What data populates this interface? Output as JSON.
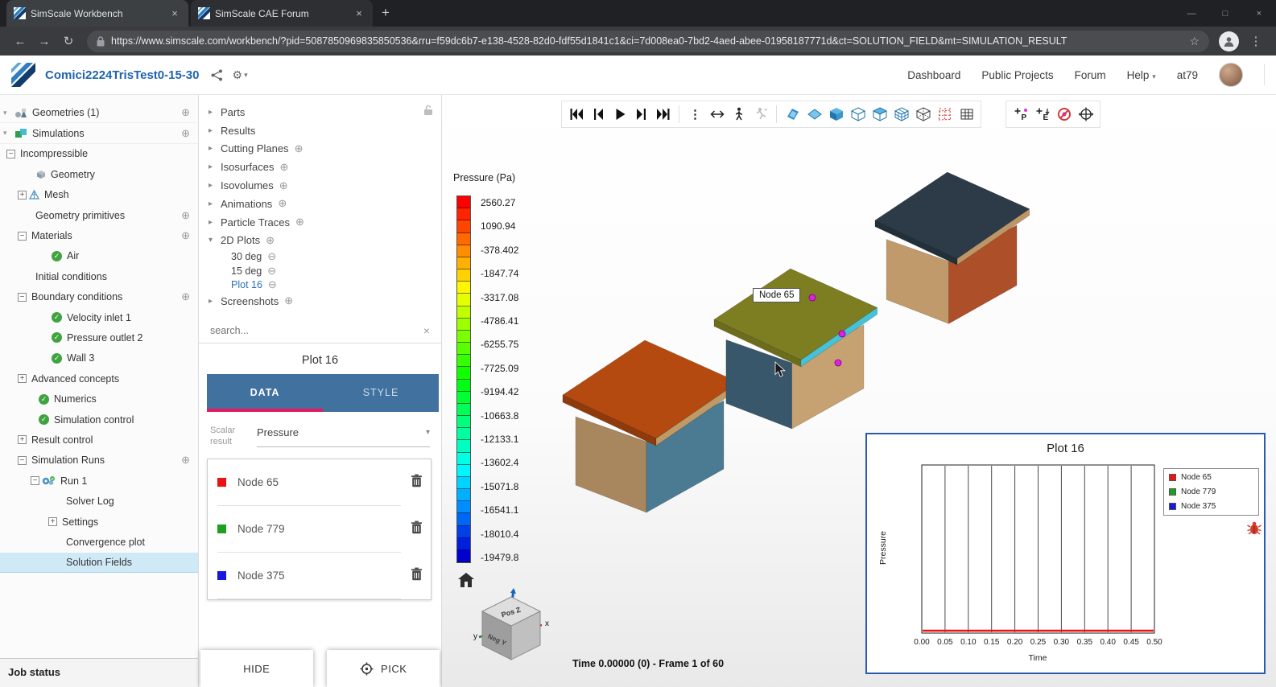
{
  "colors": {
    "brand_blue": "#1f64ad",
    "panel_tab_bg": "#40719f",
    "tab_active_underline": "#e5195f",
    "selected_row_bg": "#cfe9f7",
    "selected_tree_text": "#2a72b8",
    "check_green": "#3fa33f",
    "node_magenta": "#e020e0",
    "plot_border_blue": "#2a5caa"
  },
  "icons": {
    "back": "←",
    "forward": "→",
    "reload": "↻",
    "star": "☆",
    "kebab": "⋮",
    "minimize": "—",
    "maximize": "□",
    "close": "×",
    "new_tab": "+",
    "tab_close": "×",
    "plus_circle": "⊕",
    "minus_circle": "⊖",
    "box_plus": "+",
    "box_minus": "−",
    "chevron_right": "▸",
    "chevron_down": "▾",
    "caret_down": "▾",
    "check": "✓",
    "clear": "×",
    "gear": "⚙"
  },
  "browser": {
    "tabs": [
      {
        "title": "SimScale Workbench"
      },
      {
        "title": "SimScale CAE Forum"
      }
    ],
    "url": "https://www.simscale.com/workbench/?pid=5087850969835850536&rru=f59dc6b7-e138-4528-82d0-fdf55d1841c1&ci=7d008ea0-7bd2-4aed-abee-01958187771d&ct=SOLUTION_FIELD&mt=SIMULATION_RESULT"
  },
  "header": {
    "project_title": "Comici2224TrisTest0-15-30",
    "nav_dashboard": "Dashboard",
    "nav_public_projects": "Public Projects",
    "nav_forum": "Forum",
    "nav_help": "Help",
    "username": "at79"
  },
  "sim_tree": {
    "items": [
      {
        "label": "Geometries (1)"
      },
      {
        "label": "Simulations"
      },
      {
        "label": "Incompressible"
      },
      {
        "label": "Geometry"
      },
      {
        "label": "Mesh"
      },
      {
        "label": "Geometry primitives"
      },
      {
        "label": "Materials"
      },
      {
        "label": "Air"
      },
      {
        "label": "Initial conditions"
      },
      {
        "label": "Boundary conditions"
      },
      {
        "label": "Velocity inlet 1"
      },
      {
        "label": "Pressure outlet 2"
      },
      {
        "label": "Wall 3"
      },
      {
        "label": "Advanced concepts"
      },
      {
        "label": "Numerics"
      },
      {
        "label": "Simulation control"
      },
      {
        "label": "Result control"
      },
      {
        "label": "Simulation Runs"
      },
      {
        "label": "Run 1"
      },
      {
        "label": "Solver Log"
      },
      {
        "label": "Settings"
      },
      {
        "label": "Convergence plot"
      },
      {
        "label": "Solution Fields"
      }
    ],
    "job_status": "Job status"
  },
  "post_tree": {
    "items": [
      {
        "label": "Parts"
      },
      {
        "label": "Results"
      },
      {
        "label": "Cutting Planes"
      },
      {
        "label": "Isosurfaces"
      },
      {
        "label": "Isovolumes"
      },
      {
        "label": "Animations"
      },
      {
        "label": "Particle Traces"
      },
      {
        "label": "2D Plots"
      },
      {
        "label": "30 deg"
      },
      {
        "label": "15 deg"
      },
      {
        "label": "Plot 16"
      },
      {
        "label": "Screenshots"
      }
    ],
    "search_placeholder": "search..."
  },
  "plot_panel": {
    "title": "Plot 16",
    "tab_data": "DATA",
    "tab_style": "STYLE",
    "scalar_label": "Scalar result",
    "scalar_value": "Pressure",
    "hide_button": "HIDE",
    "pick_button": "PICK"
  },
  "legend": {
    "title": "Pressure (Pa)",
    "values": [
      "2560.27",
      "1090.94",
      "-378.402",
      "-1847.74",
      "-3317.08",
      "-4786.41",
      "-6255.75",
      "-7725.09",
      "-9194.42",
      "-10663.8",
      "-12133.1",
      "-13602.4",
      "-15071.8",
      "-16541.1",
      "-18010.4",
      "-19479.8"
    ]
  },
  "viewport": {
    "time_status": "Time 0.00000 (0) - Frame 1 of 60",
    "tooltip": "Node 65",
    "nav_cube": {
      "top_face": "Pos Z",
      "front_face": "Neg Y",
      "axis_x": "x",
      "axis_y": "y"
    },
    "node_color": "#e020e0",
    "houses": [
      {
        "roof": "#b54a10",
        "eave_left": "#8f3a0c",
        "eave_right": "#c09a66",
        "wall_left": "#a8875f",
        "wall_right": "#4b7b92"
      },
      {
        "roof": "#7d7d22",
        "eave_left": "#6b6d1c",
        "eave_right": "#45c2d8",
        "wall_left": "#39576b",
        "wall_right": "#c6a171"
      },
      {
        "roof": "#2c3b47",
        "eave_left": "#223039",
        "eave_right": "#bd9668",
        "wall_left": "#c09a6a",
        "wall_right": "#ad4f28"
      }
    ]
  },
  "chart_data": {
    "type": "line",
    "title": "Plot 16",
    "xlabel": "Time",
    "ylabel": "Pressure",
    "x_ticks": [
      "0.00",
      "0.05",
      "0.10",
      "0.15",
      "0.20",
      "0.25",
      "0.30",
      "0.35",
      "0.40",
      "0.45",
      "0.50"
    ],
    "xlim": [
      0,
      0.5
    ],
    "grid": "vertical-only",
    "legend_position": "right",
    "series": [
      {
        "name": "Node 65",
        "color": "#ee1111",
        "values": [
          0,
          0,
          0,
          0,
          0,
          0,
          0,
          0,
          0,
          0,
          0
        ]
      },
      {
        "name": "Node 779",
        "color": "#1e9e1e",
        "values": [
          0,
          0,
          0,
          0,
          0,
          0,
          0,
          0,
          0,
          0,
          0
        ]
      },
      {
        "name": "Node 375",
        "color": "#1717dd",
        "values": [
          0,
          0,
          0,
          0,
          0,
          0,
          0,
          0,
          0,
          0,
          0
        ]
      }
    ],
    "note": "Simulation at frame 1 of 60 - all traces flat at the x-axis baseline (red trace visible)"
  }
}
